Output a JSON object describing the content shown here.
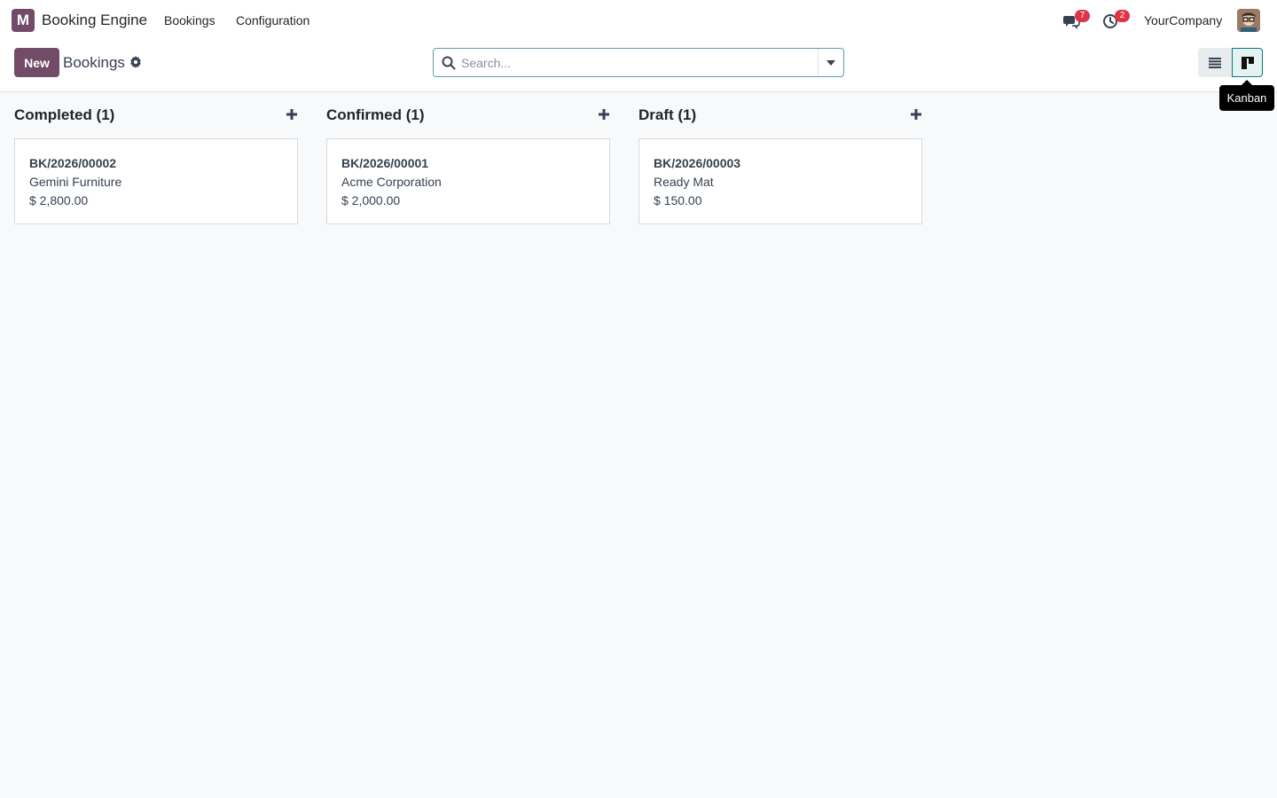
{
  "navbar": {
    "logo_letter": "M",
    "app_name": "Booking Engine",
    "menus": [
      "Bookings",
      "Configuration"
    ],
    "chat_count": "7",
    "activity_count": "2",
    "company": "YourCompany"
  },
  "control_panel": {
    "new_label": "New",
    "title": "Bookings",
    "search_placeholder": "Search...",
    "views": [
      "list",
      "kanban"
    ],
    "active_view": "kanban",
    "tooltip": "Kanban"
  },
  "kanban": {
    "columns": [
      {
        "title": "Completed (1)",
        "cards": [
          {
            "ref": "BK/2026/00002",
            "partner": "Gemini Furniture",
            "amount": "$ 2,800.00"
          }
        ]
      },
      {
        "title": "Confirmed (1)",
        "cards": [
          {
            "ref": "BK/2026/00001",
            "partner": "Acme Corporation",
            "amount": "$ 2,000.00"
          }
        ]
      },
      {
        "title": "Draft (1)",
        "cards": [
          {
            "ref": "BK/2026/00003",
            "partner": "Ready Mat",
            "amount": "$ 150.00"
          }
        ]
      }
    ]
  },
  "colors": {
    "brand": "#714b67",
    "accent": "#017e84",
    "badge": "#dc3545",
    "background": "#f8f9fb"
  },
  "icons": [
    "chat-icon",
    "clock-icon",
    "gear-icon",
    "search-icon",
    "caret-down-icon",
    "list-view-icon",
    "kanban-view-icon",
    "plus-icon"
  ]
}
